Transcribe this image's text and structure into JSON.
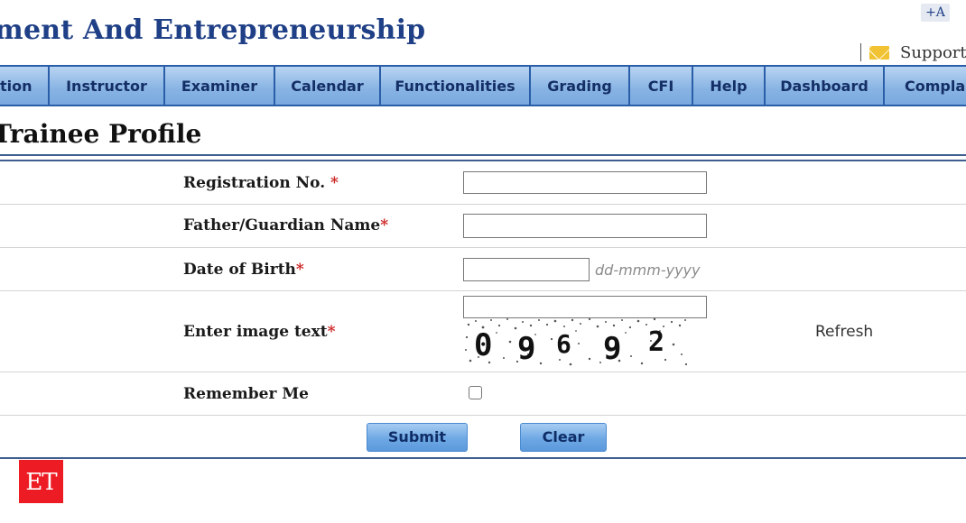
{
  "header": {
    "title": "ment And Entrepreneurship",
    "font_size_label": "+A",
    "support_label": "Support"
  },
  "nav": {
    "items": [
      {
        "label": "tion",
        "id": "cut-left"
      },
      {
        "label": "Instructor",
        "id": "instructor"
      },
      {
        "label": "Examiner",
        "id": "examiner"
      },
      {
        "label": "Calendar",
        "id": "calendar"
      },
      {
        "label": "Functionalities",
        "id": "functionalities"
      },
      {
        "label": "Grading",
        "id": "grading"
      },
      {
        "label": "CFI",
        "id": "cfi"
      },
      {
        "label": "Help",
        "id": "help"
      },
      {
        "label": "Dashboard",
        "id": "dashboard"
      },
      {
        "label": "Complai",
        "id": "complaints"
      }
    ]
  },
  "page": {
    "title": "Trainee Profile"
  },
  "form": {
    "registration": {
      "label": "Registration No. ",
      "required": "*",
      "value": ""
    },
    "guardian": {
      "label": "Father/Guardian Name",
      "required": "*",
      "value": ""
    },
    "dob": {
      "label": "Date of Birth",
      "required": "*",
      "value": "",
      "hint": "dd-mmm-yyyy"
    },
    "captcha": {
      "label": "Enter image text",
      "required": "*",
      "value": "",
      "image_text": "09692",
      "refresh_label": "Refresh"
    },
    "remember": {
      "label": "Remember Me",
      "checked": false
    },
    "submit_label": "Submit",
    "clear_label": "Clear"
  },
  "logo": {
    "text": "ET",
    "color": "#ed1c24"
  },
  "colors": {
    "accent": "#1f3f86",
    "nav_bg": "#7aa9df",
    "nav_border": "#2a5ea8",
    "required": "#cc2222"
  }
}
